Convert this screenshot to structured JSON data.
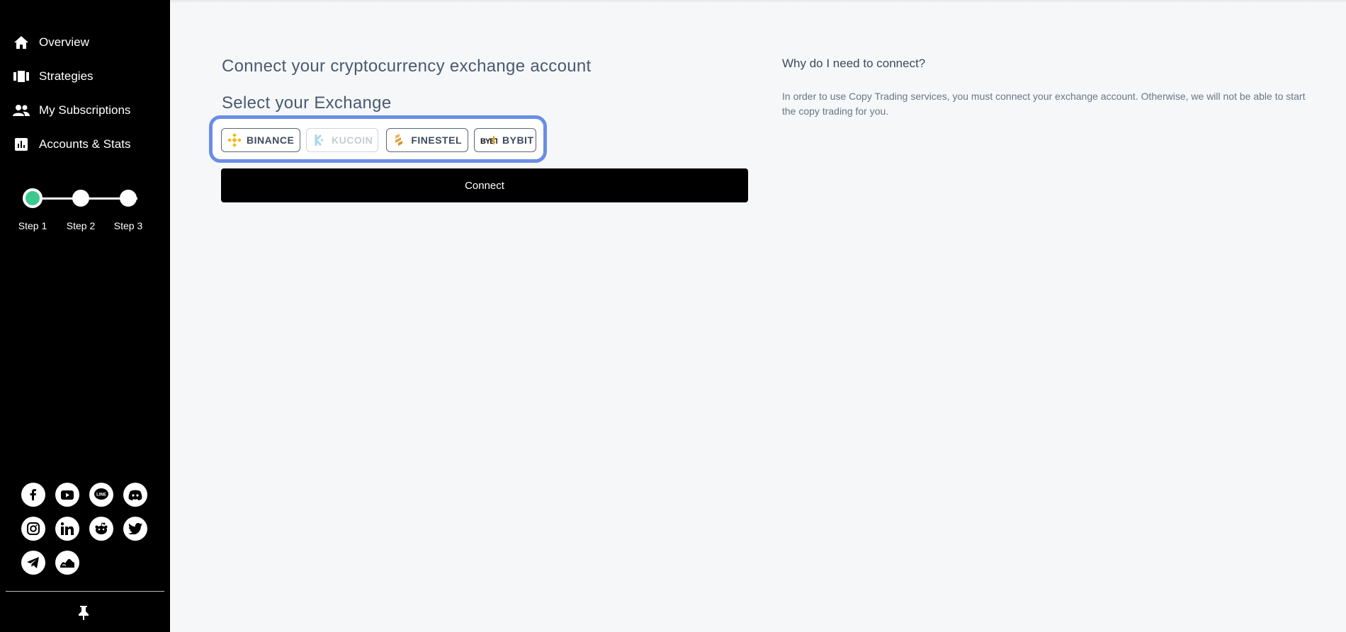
{
  "sidebar": {
    "nav": [
      {
        "label": "Overview",
        "icon": "home-icon"
      },
      {
        "label": "Strategies",
        "icon": "strategies-icon"
      },
      {
        "label": "My Subscriptions",
        "icon": "users-icon"
      },
      {
        "label": "Accounts & Stats",
        "icon": "stats-icon"
      }
    ],
    "steps": [
      "Step 1",
      "Step 2",
      "Step 3"
    ],
    "active_step": 1,
    "socials": [
      "facebook-icon",
      "youtube-icon",
      "line-icon",
      "discord-icon",
      "instagram-icon",
      "linkedin-icon",
      "reddit-icon",
      "twitter-icon",
      "telegram-icon",
      "tradingview-icon"
    ]
  },
  "main": {
    "title": "Connect your cryptocurrency exchange account",
    "subtitle": "Select your Exchange",
    "exchanges": [
      {
        "label": "BINANCE",
        "enabled": true
      },
      {
        "label": "KUCOIN",
        "enabled": false
      },
      {
        "label": "FINESTEL",
        "enabled": true
      },
      {
        "label": "BYBIT",
        "enabled": true
      }
    ],
    "connect_label": "Connect",
    "why": {
      "title": "Why do I need to connect?",
      "text": "In order to use Copy Trading services, you must connect your exchange account. Otherwise, we will not be able to start the copy trading for you."
    }
  },
  "colors": {
    "sidebar_bg": "#000000",
    "page_bg": "#f5f7f9",
    "active_step": "#3cc88f",
    "highlight_border": "#6a8de6",
    "heading_text": "#4a5a70"
  }
}
